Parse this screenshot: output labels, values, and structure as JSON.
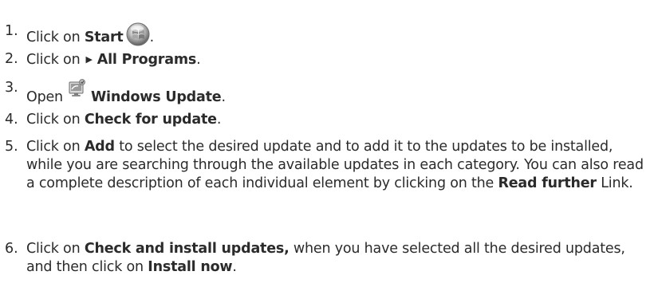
{
  "steps": [
    {
      "num": "1.",
      "pre": "Click on ",
      "bold": "Start",
      "post": ".",
      "icon": "windows-start-orb-icon"
    },
    {
      "num": "2.",
      "pre": "Click on",
      "bold": "All Programs",
      "post": ".",
      "icon": "triangle-right-icon"
    },
    {
      "num": "3.",
      "pre": "Open",
      "bold": "Windows Update",
      "post": ".",
      "icon": "windows-update-icon"
    },
    {
      "num": "4.",
      "pre": "Click on ",
      "bold": "Check for update",
      "post": "."
    },
    {
      "num": "5.",
      "pre": "Click on ",
      "bold": "Add",
      "mid": " to select the desired update and to add it to the updates to be installed, while you are searching through the available updates in each category. You can also read a complete description of each individual element by clicking on the  ",
      "bold2": "Read further",
      "post": " Link."
    },
    {
      "num": "6.",
      "pre": "Click on ",
      "bold": "Check and install updates,",
      "mid": " when you have selected all the desired updates, and then click on ",
      "bold2": "Install now",
      "post": "."
    }
  ]
}
